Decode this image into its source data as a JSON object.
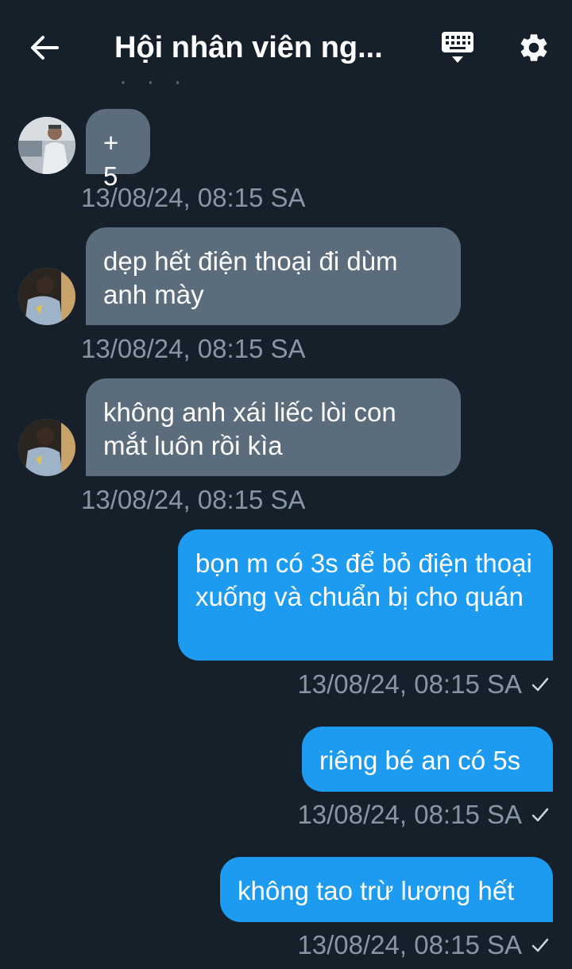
{
  "header": {
    "title": "Hội nhân viên ng...",
    "back_icon": "arrow-left-icon",
    "keyboard_icon": "keyboard-icon",
    "settings_icon": "gear-icon"
  },
  "messages": [
    {
      "direction": "incoming",
      "text": "+5",
      "time": "13/08/24, 08:15 SA"
    },
    {
      "direction": "incoming",
      "text": "dẹp hết điện thoại đi dùm anh mày",
      "time": "13/08/24, 08:15 SA"
    },
    {
      "direction": "incoming",
      "text": "không anh xái liếc lòi con mắt luôn rồi kìa",
      "time": "13/08/24, 08:15 SA"
    },
    {
      "direction": "outgoing",
      "text": "bọn m có 3s để bỏ điện thoại xuống và chuẩn bị cho quán",
      "time": "13/08/24, 08:15 SA",
      "status": "sent"
    },
    {
      "direction": "outgoing",
      "text": "riêng bé an có 5s",
      "time": "13/08/24, 08:15 SA",
      "status": "sent"
    },
    {
      "direction": "outgoing",
      "text": "không tao trừ lương hết",
      "time": "13/08/24, 08:15 SA",
      "status": "sent"
    }
  ],
  "colors": {
    "background": "#15202b",
    "incoming_bubble": "#5b6c7c",
    "outgoing_bubble": "#1d9bf0",
    "timestamp": "#8796a5"
  }
}
